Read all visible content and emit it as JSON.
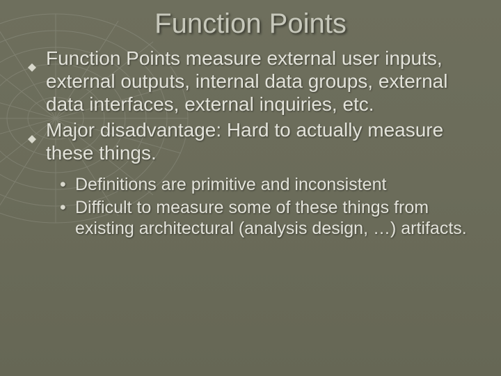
{
  "title": "Function Points",
  "level1": [
    "Function Points measure external user inputs, external outputs, internal data groups, external data interfaces, external inquiries, etc.",
    "Major disadvantage:  Hard to actually measure these things."
  ],
  "level2": [
    "Definitions are primitive and inconsistent",
    "Difficult to measure some of these things from existing architectural (analysis design, …)   artifacts."
  ]
}
